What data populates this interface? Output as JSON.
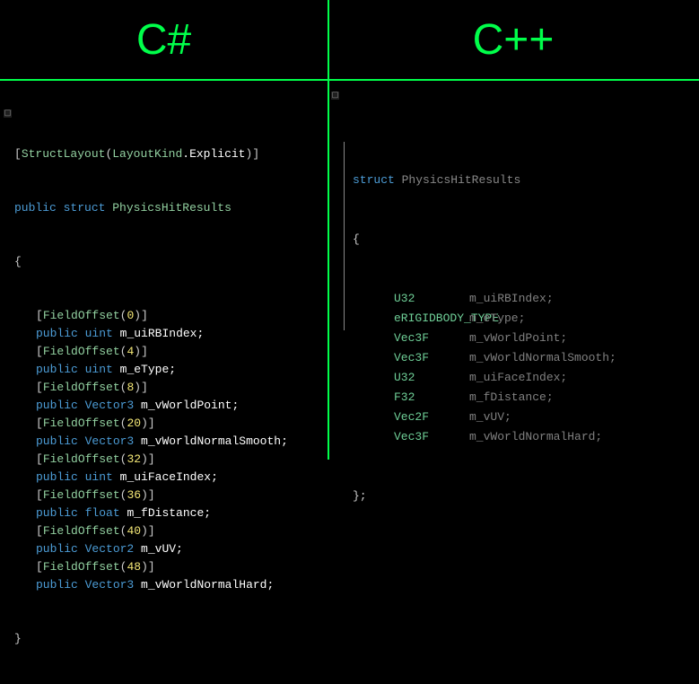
{
  "headers": {
    "left": "C#",
    "right": "C++"
  },
  "csharp": {
    "structLayoutAttr": {
      "name": "StructLayout",
      "enumType": "LayoutKind",
      "enumValue": "Explicit"
    },
    "structDecl": {
      "access": "public",
      "kw": "struct",
      "name": "PhysicsHitResults"
    },
    "fields": [
      {
        "offset": "0",
        "access": "public",
        "type": "uint",
        "name": "m_uiRBIndex"
      },
      {
        "offset": "4",
        "access": "public",
        "type": "uint",
        "name": "m_eType"
      },
      {
        "offset": "8",
        "access": "public",
        "type": "Vector3",
        "name": "m_vWorldPoint"
      },
      {
        "offset": "20",
        "access": "public",
        "type": "Vector3",
        "name": "m_vWorldNormalSmooth"
      },
      {
        "offset": "32",
        "access": "public",
        "type": "uint",
        "name": "m_uiFaceIndex"
      },
      {
        "offset": "36",
        "access": "public",
        "type": "float",
        "name": "m_fDistance"
      },
      {
        "offset": "40",
        "access": "public",
        "type": "Vector2",
        "name": "m_vUV"
      },
      {
        "offset": "48",
        "access": "public",
        "type": "Vector3",
        "name": "m_vWorldNormalHard"
      }
    ],
    "fieldOffsetAttr": "FieldOffset"
  },
  "cpp": {
    "kw": "struct",
    "name": "PhysicsHitResults",
    "fields": [
      {
        "type": "U32",
        "name": "m_uiRBIndex;"
      },
      {
        "type": "eRIGIDBODY_TYPE",
        "name": "m_eType;"
      },
      {
        "type": "Vec3F",
        "name": "m_vWorldPoint;"
      },
      {
        "type": "Vec3F",
        "name": "m_vWorldNormalSmooth;"
      },
      {
        "type": "U32",
        "name": "m_uiFaceIndex;"
      },
      {
        "type": "F32",
        "name": "m_fDistance;"
      },
      {
        "type": "Vec2F",
        "name": "m_vUV;"
      },
      {
        "type": "Vec3F",
        "name": "m_vWorldNormalHard;"
      }
    ],
    "closing": "};"
  }
}
